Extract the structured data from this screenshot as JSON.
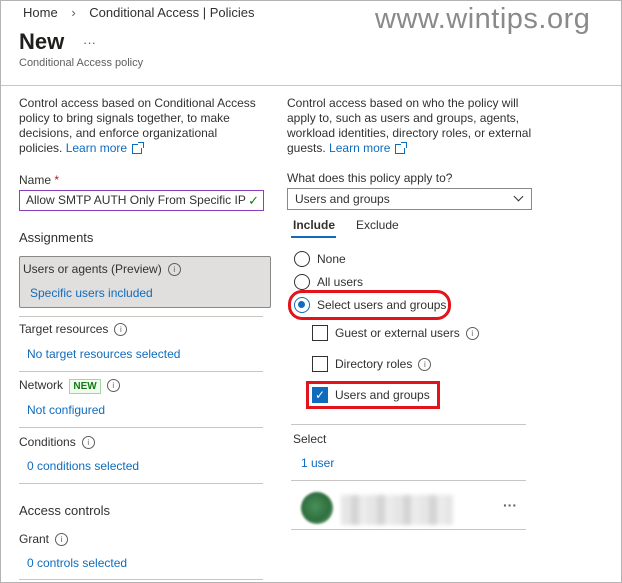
{
  "breadcrumb": {
    "home": "Home",
    "sep": "›",
    "path": "Conditional Access | Policies"
  },
  "watermark": "www.wintips.org",
  "page": {
    "title": "New",
    "more": "···",
    "subtitle": "Conditional Access policy"
  },
  "left": {
    "intro": "Control access based on Conditional Access policy to bring signals together, to make decisions, and enforce organizational policies.",
    "learn_more": "Learn more",
    "name_label": "Name",
    "name_required": "*",
    "name_value": "Allow SMTP AUTH Only From Specific IP",
    "assignments": "Assignments",
    "users_title": "Users or agents (Preview)",
    "users_value": "Specific users included",
    "target_title": "Target resources",
    "target_value": "No target resources selected",
    "network_title": "Network",
    "network_badge": "NEW",
    "network_value": "Not configured",
    "conditions_title": "Conditions",
    "conditions_value": "0 conditions selected",
    "access_controls": "Access controls",
    "grant_title": "Grant",
    "grant_value": "0 controls selected"
  },
  "right": {
    "intro": "Control access based on who the policy will apply to, such as users and groups, agents, workload identities, directory roles, or external guests.",
    "learn_more": "Learn more",
    "apply_label": "What does this policy apply to?",
    "apply_value": "Users and groups",
    "tabs": [
      "Include",
      "Exclude"
    ],
    "radios": [
      "None",
      "All users",
      "Select users and groups"
    ],
    "checkboxes": [
      "Guest or external users",
      "Directory roles",
      "Users and groups"
    ],
    "select_label": "Select",
    "select_value": "1 user",
    "more": "···"
  },
  "colors": {
    "accent": "#0f6cbd",
    "highlight": "#e3121b",
    "success": "#107c10"
  }
}
